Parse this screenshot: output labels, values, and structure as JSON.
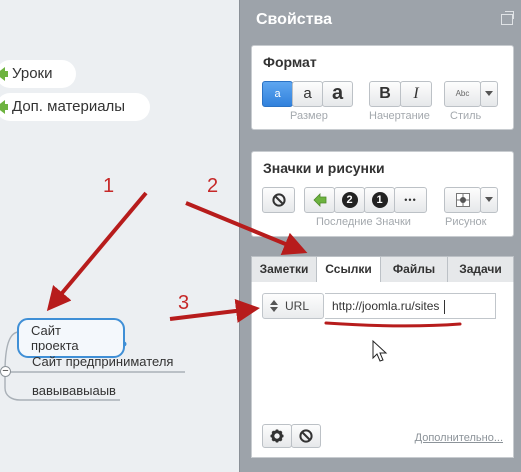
{
  "mindmap": {
    "topics": [
      {
        "label": "Уроки"
      },
      {
        "label": "Доп. материалы"
      }
    ],
    "nodes": [
      {
        "label": "Сайт проекта"
      },
      {
        "label": "Сайт предпринимателя"
      },
      {
        "label": "вавывавыаыв"
      }
    ],
    "collapse_symbol": "−",
    "annotations": [
      "1",
      "2",
      "3"
    ]
  },
  "panel": {
    "title": "Свойства",
    "format": {
      "title": "Формат",
      "size_buttons": [
        "a",
        "a",
        "a"
      ],
      "bold_label": "B",
      "italic_label": "I",
      "style_label": "Abc",
      "captions": {
        "size": "Размер",
        "style_type": "Начертание",
        "style": "Стиль"
      }
    },
    "icons": {
      "title": "Значки и рисунки",
      "recent_badges": [
        "2",
        "1"
      ],
      "more_label": "•••",
      "captions": {
        "recent": "Последние Значки",
        "picture": "Рисунок"
      }
    },
    "tabs": [
      "Заметки",
      "Ссылки",
      "Файлы",
      "Задачи"
    ],
    "active_tab": "Ссылки",
    "links": {
      "type_label": "URL",
      "url_value": "http://joomla.ru/sites",
      "more_link": "Дополнительно..."
    }
  },
  "colors": {
    "accent_blue": "#3f8fd6",
    "annotation_red": "#b71c1c",
    "panel_bg": "#9da3aa",
    "arrow_green": "#6db33f"
  }
}
